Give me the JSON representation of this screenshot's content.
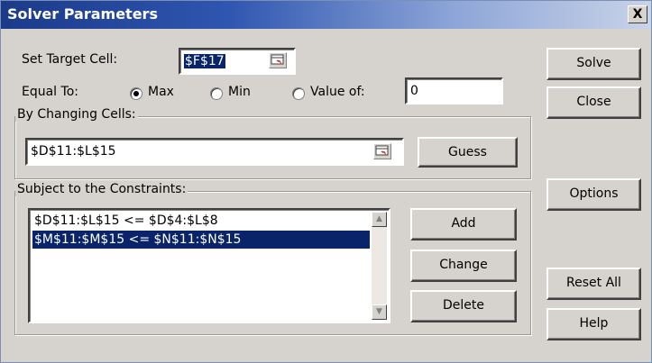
{
  "window": {
    "title": "Solver Parameters",
    "close_glyph": "X"
  },
  "target": {
    "label": "Set Target Cell:",
    "value": "$F$17"
  },
  "equal_to": {
    "label": "Equal To:",
    "options": [
      {
        "label": "Max",
        "selected": true
      },
      {
        "label": "Min",
        "selected": false
      },
      {
        "label": "Value of:",
        "selected": false
      }
    ],
    "value_of": "0"
  },
  "changing": {
    "label": "By Changing Cells:",
    "value": "$D$11:$L$15"
  },
  "constraints": {
    "label": "Subject to the Constraints:",
    "items": [
      "$D$11:$L$15 <= $D$4:$L$8",
      "$M$11:$M$15 <= $N$11:$N$15"
    ],
    "selected_index": 1
  },
  "buttons": {
    "solve": "Solve",
    "close": "Close",
    "guess": "Guess",
    "options": "Options",
    "add": "Add",
    "change": "Change",
    "delete": "Delete",
    "reset_all": "Reset All",
    "help": "Help"
  }
}
